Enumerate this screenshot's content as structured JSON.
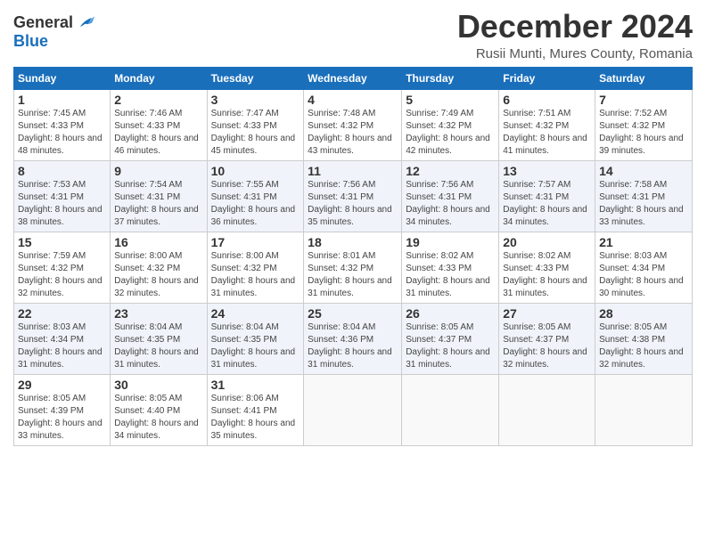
{
  "header": {
    "logo_line1": "General",
    "logo_line2": "Blue",
    "month_title": "December 2024",
    "location": "Rusii Munti, Mures County, Romania"
  },
  "weekdays": [
    "Sunday",
    "Monday",
    "Tuesday",
    "Wednesday",
    "Thursday",
    "Friday",
    "Saturday"
  ],
  "weeks": [
    [
      {
        "day": "1",
        "sunrise": "7:45 AM",
        "sunset": "4:33 PM",
        "daylight": "8 hours and 48 minutes."
      },
      {
        "day": "2",
        "sunrise": "7:46 AM",
        "sunset": "4:33 PM",
        "daylight": "8 hours and 46 minutes."
      },
      {
        "day": "3",
        "sunrise": "7:47 AM",
        "sunset": "4:33 PM",
        "daylight": "8 hours and 45 minutes."
      },
      {
        "day": "4",
        "sunrise": "7:48 AM",
        "sunset": "4:32 PM",
        "daylight": "8 hours and 43 minutes."
      },
      {
        "day": "5",
        "sunrise": "7:49 AM",
        "sunset": "4:32 PM",
        "daylight": "8 hours and 42 minutes."
      },
      {
        "day": "6",
        "sunrise": "7:51 AM",
        "sunset": "4:32 PM",
        "daylight": "8 hours and 41 minutes."
      },
      {
        "day": "7",
        "sunrise": "7:52 AM",
        "sunset": "4:32 PM",
        "daylight": "8 hours and 39 minutes."
      }
    ],
    [
      {
        "day": "8",
        "sunrise": "7:53 AM",
        "sunset": "4:31 PM",
        "daylight": "8 hours and 38 minutes."
      },
      {
        "day": "9",
        "sunrise": "7:54 AM",
        "sunset": "4:31 PM",
        "daylight": "8 hours and 37 minutes."
      },
      {
        "day": "10",
        "sunrise": "7:55 AM",
        "sunset": "4:31 PM",
        "daylight": "8 hours and 36 minutes."
      },
      {
        "day": "11",
        "sunrise": "7:56 AM",
        "sunset": "4:31 PM",
        "daylight": "8 hours and 35 minutes."
      },
      {
        "day": "12",
        "sunrise": "7:56 AM",
        "sunset": "4:31 PM",
        "daylight": "8 hours and 34 minutes."
      },
      {
        "day": "13",
        "sunrise": "7:57 AM",
        "sunset": "4:31 PM",
        "daylight": "8 hours and 34 minutes."
      },
      {
        "day": "14",
        "sunrise": "7:58 AM",
        "sunset": "4:31 PM",
        "daylight": "8 hours and 33 minutes."
      }
    ],
    [
      {
        "day": "15",
        "sunrise": "7:59 AM",
        "sunset": "4:32 PM",
        "daylight": "8 hours and 32 minutes."
      },
      {
        "day": "16",
        "sunrise": "8:00 AM",
        "sunset": "4:32 PM",
        "daylight": "8 hours and 32 minutes."
      },
      {
        "day": "17",
        "sunrise": "8:00 AM",
        "sunset": "4:32 PM",
        "daylight": "8 hours and 31 minutes."
      },
      {
        "day": "18",
        "sunrise": "8:01 AM",
        "sunset": "4:32 PM",
        "daylight": "8 hours and 31 minutes."
      },
      {
        "day": "19",
        "sunrise": "8:02 AM",
        "sunset": "4:33 PM",
        "daylight": "8 hours and 31 minutes."
      },
      {
        "day": "20",
        "sunrise": "8:02 AM",
        "sunset": "4:33 PM",
        "daylight": "8 hours and 31 minutes."
      },
      {
        "day": "21",
        "sunrise": "8:03 AM",
        "sunset": "4:34 PM",
        "daylight": "8 hours and 30 minutes."
      }
    ],
    [
      {
        "day": "22",
        "sunrise": "8:03 AM",
        "sunset": "4:34 PM",
        "daylight": "8 hours and 31 minutes."
      },
      {
        "day": "23",
        "sunrise": "8:04 AM",
        "sunset": "4:35 PM",
        "daylight": "8 hours and 31 minutes."
      },
      {
        "day": "24",
        "sunrise": "8:04 AM",
        "sunset": "4:35 PM",
        "daylight": "8 hours and 31 minutes."
      },
      {
        "day": "25",
        "sunrise": "8:04 AM",
        "sunset": "4:36 PM",
        "daylight": "8 hours and 31 minutes."
      },
      {
        "day": "26",
        "sunrise": "8:05 AM",
        "sunset": "4:37 PM",
        "daylight": "8 hours and 31 minutes."
      },
      {
        "day": "27",
        "sunrise": "8:05 AM",
        "sunset": "4:37 PM",
        "daylight": "8 hours and 32 minutes."
      },
      {
        "day": "28",
        "sunrise": "8:05 AM",
        "sunset": "4:38 PM",
        "daylight": "8 hours and 32 minutes."
      }
    ],
    [
      {
        "day": "29",
        "sunrise": "8:05 AM",
        "sunset": "4:39 PM",
        "daylight": "8 hours and 33 minutes."
      },
      {
        "day": "30",
        "sunrise": "8:05 AM",
        "sunset": "4:40 PM",
        "daylight": "8 hours and 34 minutes."
      },
      {
        "day": "31",
        "sunrise": "8:06 AM",
        "sunset": "4:41 PM",
        "daylight": "8 hours and 35 minutes."
      },
      null,
      null,
      null,
      null
    ]
  ]
}
